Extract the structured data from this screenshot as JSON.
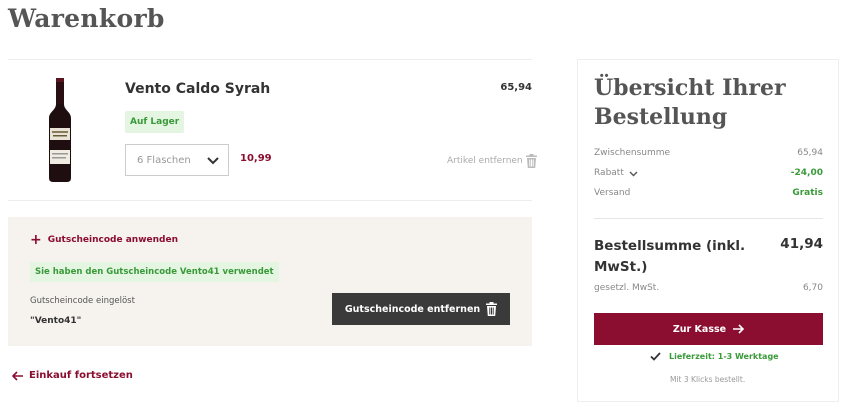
{
  "page": {
    "title": "Warenkorb"
  },
  "cart": {
    "items": [
      {
        "name": "Vento Caldo Syrah",
        "price": "65,94",
        "stock": "Auf Lager",
        "quantity_value": "6 Flaschen",
        "unit_price": "10,99",
        "remove_label": "Artikel entfernen"
      }
    ]
  },
  "voucher": {
    "apply_label": "Gutscheincode anwenden",
    "applied_message": "Sie haben den Gutscheincode Vento41 verwendet",
    "redeemed_label": "Gutscheincode eingelöst",
    "code": "\"Vento41\"",
    "remove_button": "Gutscheincode entfernen"
  },
  "links": {
    "continue_shopping": "Einkauf fortsetzen"
  },
  "summary": {
    "title": "Übersicht Ihrer Bestellung",
    "subtotal_label": "Zwischensumme",
    "subtotal_value": "65,94",
    "discount_label": "Rabatt",
    "discount_value": "-24,00",
    "shipping_label": "Versand",
    "shipping_value": "Gratis",
    "total_label": "Bestellsumme (inkl. MwSt.)",
    "total_value": "41,94",
    "tax_label": "gesetzl. MwSt.",
    "tax_value": "6,70",
    "checkout_button": "Zur Kasse",
    "delivery": "Lieferzeit: 1-3 Werktage",
    "klicks_note": "Mit 3 Klicks bestellt."
  },
  "colors": {
    "accent": "#8b0d2f",
    "success": "#3a9a3a",
    "dark_button": "#3a3a3a",
    "voucher_bg": "#f6f3ee"
  },
  "icons": {
    "quantity_dropdown": "chevron-down-icon",
    "remove_item": "trash-icon",
    "apply_voucher": "plus-icon",
    "remove_voucher": "trash-icon",
    "continue": "arrow-left-icon",
    "discount_toggle": "chevron-down-icon",
    "checkout": "arrow-right-icon",
    "delivery": "check-icon"
  }
}
